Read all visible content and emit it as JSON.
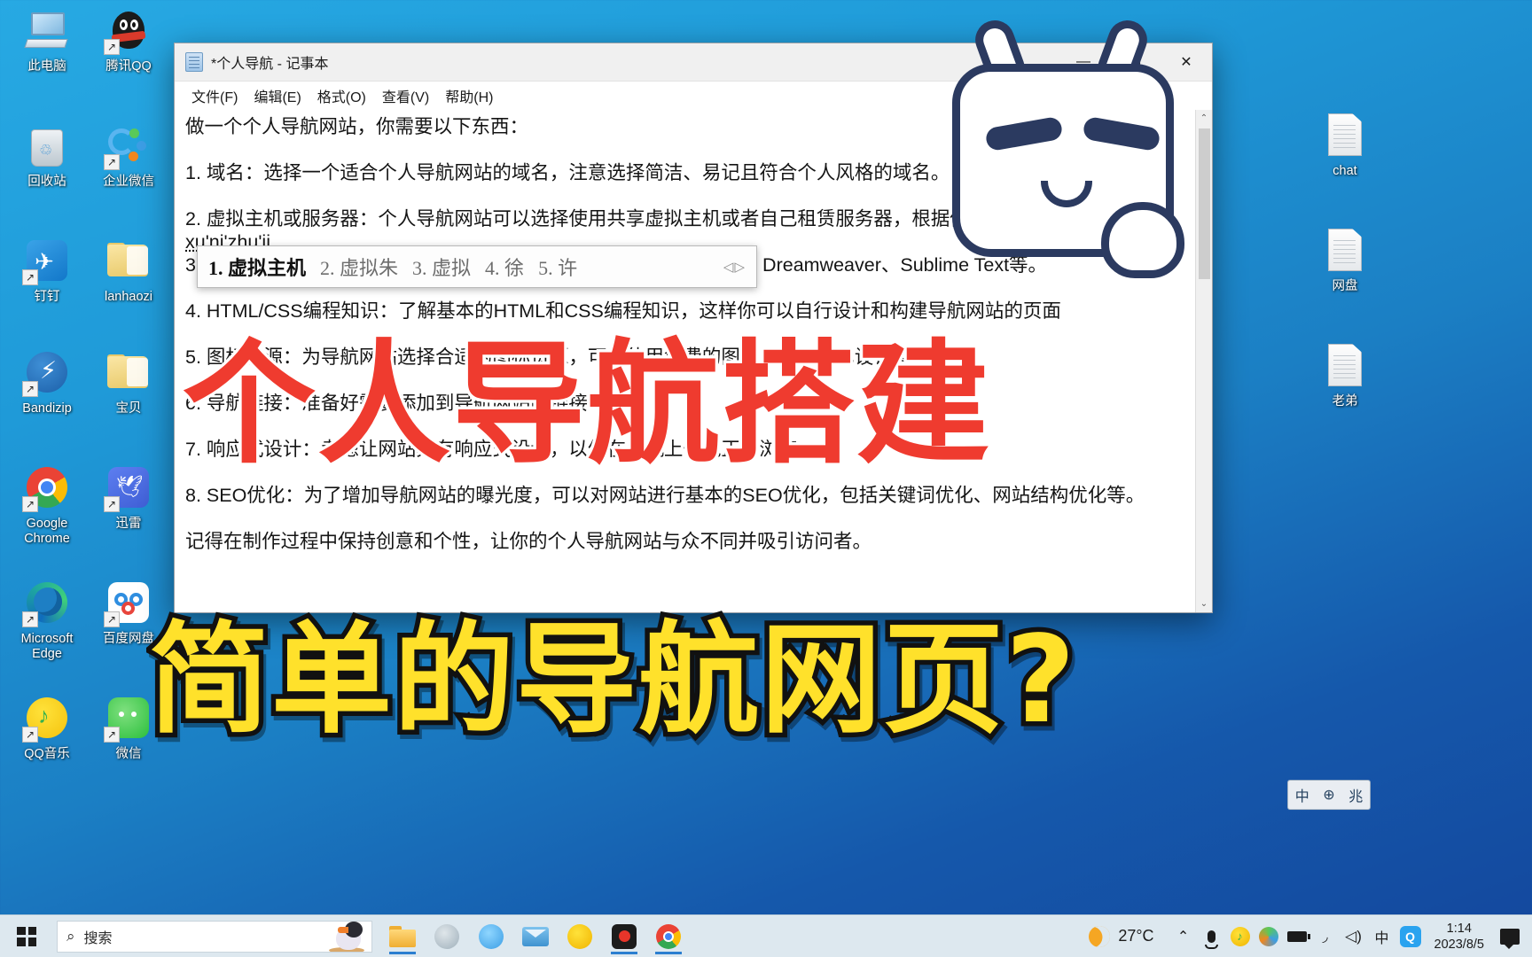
{
  "desktop": {
    "icons_left_col1": [
      {
        "label": "此电脑",
        "icon": "this-pc-icon",
        "shortcut": false
      },
      {
        "label": "回收站",
        "icon": "recycle-bin-icon",
        "shortcut": false
      },
      {
        "label": "钉钉",
        "icon": "dingtalk-icon",
        "shortcut": true
      },
      {
        "label": "Bandizip",
        "icon": "bandizip-icon",
        "shortcut": true
      },
      {
        "label": "Google Chrome",
        "icon": "chrome-icon",
        "shortcut": true
      },
      {
        "label": "Microsoft Edge",
        "icon": "edge-icon",
        "shortcut": true
      },
      {
        "label": "QQ音乐",
        "icon": "qq-music-icon",
        "shortcut": true
      }
    ],
    "icons_left_col2": [
      {
        "label": "腾讯QQ",
        "icon": "tencent-qq-icon",
        "shortcut": true
      },
      {
        "label": "企业微信",
        "icon": "wecom-icon",
        "shortcut": true
      },
      {
        "label": "lanhaozi",
        "icon": "folder-icon",
        "shortcut": false
      },
      {
        "label": "宝贝",
        "icon": "folder-icon",
        "shortcut": false
      },
      {
        "label": "迅雷",
        "icon": "xunlei-icon",
        "shortcut": true
      },
      {
        "label": "百度网盘",
        "icon": "baidu-netdisk-icon",
        "shortcut": true
      },
      {
        "label": "微信",
        "icon": "wechat-icon",
        "shortcut": true
      }
    ],
    "icons_right": [
      {
        "label": "chat",
        "icon": "text-file-icon",
        "shortcut": false
      },
      {
        "label": "网盘",
        "icon": "text-file-icon",
        "shortcut": false
      },
      {
        "label": "老弟",
        "icon": "text-file-icon",
        "shortcut": false
      }
    ]
  },
  "notepad": {
    "title": "*个人导航 - 记事本",
    "icon": "notepad-icon",
    "window_buttons": {
      "minimize": "—",
      "maximize": "▢",
      "close": "✕"
    },
    "menu": [
      {
        "label": "文件(F)"
      },
      {
        "label": "编辑(E)"
      },
      {
        "label": "格式(O)"
      },
      {
        "label": "查看(V)"
      },
      {
        "label": "帮助(H)"
      }
    ],
    "lines": [
      "做一个个人导航网站，你需要以下东西：",
      "",
      "1. 域名：选择一个适合个人导航网站的域名，注意选择简洁、易记且符合个人风格的域名。   com",
      "",
      "2. 虚拟主机或服务器：个人导航网站可以选择使用共享虚拟主机或者自己租赁服务器，根据你的需求",
      "",
      "3. 网页设计工具：选择一款适合自己使用的网页设计工具，如Adobe Dreamweaver、Sublime Text等。",
      "",
      "4. HTML/CSS编程知识：了解基本的HTML和CSS编程知识，这样你可以自行设计和构建导航网站的页面",
      "",
      "5. 图标资源：为导航网站选择合适的图标资源，可以使用免费的图标库或者自己设计图标",
      "",
      "6. 导航链接：准备好需要添加到导航网站的链接",
      "",
      "7. 响应式设计：考虑让网站具有响应式设计，以便在手机上也能正常浏览",
      "",
      "8. SEO优化：为了增加导航网站的曝光度，可以对网站进行基本的SEO优化，包括关键词优化、网站结构优化等。",
      "",
      "记得在制作过程中保持创意和个性，让你的个人导航网站与众不同并吸引访问者。"
    ],
    "ime_composition": "xu'ni'zhu'ji",
    "scrollbar": {
      "up": "⌃",
      "down": "⌄"
    }
  },
  "ime_candidates": {
    "items": [
      "1. 虚拟主机",
      "2. 虚拟朱",
      "3. 虚拟",
      "4. 徐",
      "5. 许"
    ],
    "nav": "◁▷"
  },
  "ime_status": {
    "mode": "中",
    "shape": "⊕",
    "extra": "兆"
  },
  "captions": {
    "red": "个人导航搭建",
    "yellow": "简单的导航网页?",
    "red_color": "#ef3b2f",
    "yellow_color": "#ffe12b"
  },
  "mascot": {
    "name": "bilibili-mascot"
  },
  "taskbar": {
    "start": "start-button",
    "search": {
      "placeholder": "搜索",
      "icon": "search-icon",
      "image": "puffin-image"
    },
    "apps": [
      {
        "name": "file-explorer",
        "active": true
      },
      {
        "name": "app-gray-circle",
        "active": false
      },
      {
        "name": "wecom-taskbar",
        "active": false
      },
      {
        "name": "mail-app",
        "active": false
      },
      {
        "name": "qq-music-taskbar",
        "active": false
      },
      {
        "name": "screen-recorder",
        "active": true
      },
      {
        "name": "chrome-taskbar",
        "active": true
      }
    ],
    "weather": {
      "icon": "moon-icon",
      "temperature": "27°C"
    },
    "tray": [
      {
        "name": "show-hidden-icons",
        "glyph": "⌃"
      },
      {
        "name": "microphone-icon",
        "glyph": "🎤"
      },
      {
        "name": "qq-music-tray-icon",
        "glyph": "♪"
      },
      {
        "name": "wecom-tray-icon",
        "glyph": "◕"
      },
      {
        "name": "battery-icon",
        "glyph": "▭"
      },
      {
        "name": "wifi-icon",
        "glyph": "◞"
      },
      {
        "name": "volume-icon",
        "glyph": "🔊"
      },
      {
        "name": "ime-tray-icon",
        "glyph": "中"
      },
      {
        "name": "qq-tray-icon",
        "glyph": "Q"
      }
    ],
    "clock": {
      "time": "1:14",
      "date": "2023/8/5"
    },
    "action_center": "action-center-icon"
  }
}
